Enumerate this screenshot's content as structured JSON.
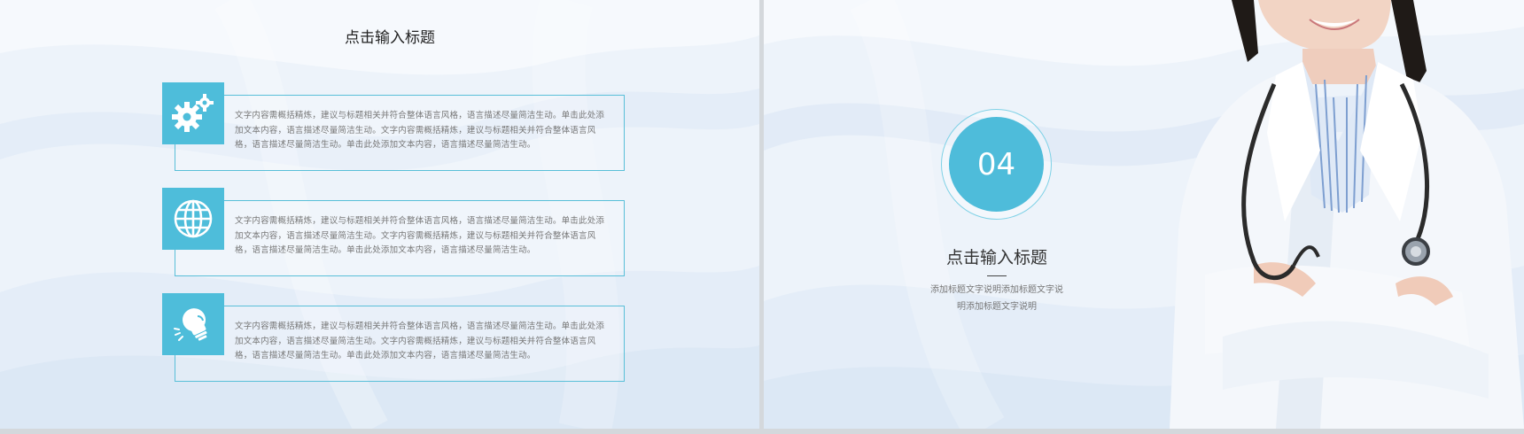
{
  "left_slide": {
    "title": "点击输入标题",
    "items": [
      {
        "icon": "gears-icon",
        "text": "文字内容需概括精炼，建议与标题相关并符合整体语言风格，语言描述尽量简洁生动。单击此处添加文本内容，语言描述尽量简洁生动。文字内容需概括精炼，建议与标题相关并符合整体语言风格，语言描述尽量简洁生动。单击此处添加文本内容，语言描述尽量简洁生动。"
      },
      {
        "icon": "globe-icon",
        "text": "文字内容需概括精炼，建议与标题相关并符合整体语言风格，语言描述尽量简洁生动。单击此处添加文本内容，语言描述尽量简洁生动。文字内容需概括精炼，建议与标题相关并符合整体语言风格，语言描述尽量简洁生动。单击此处添加文本内容，语言描述尽量简洁生动。"
      },
      {
        "icon": "lightbulb-icon",
        "text": "文字内容需概括精炼，建议与标题相关并符合整体语言风格，语言描述尽量简洁生动。单击此处添加文本内容，语言描述尽量简洁生动。文字内容需概括精炼，建议与标题相关并符合整体语言风格，语言描述尽量简洁生动。单击此处添加文本内容，语言描述尽量简洁生动。"
      }
    ]
  },
  "right_slide": {
    "number": "04",
    "title": "点击输入标题",
    "description": "添加标题文字说明添加标题文字说明添加标题文字说明"
  },
  "colors": {
    "accent": "#4ebdda",
    "frame": "#59bfd8",
    "background": "#edf3fa"
  }
}
